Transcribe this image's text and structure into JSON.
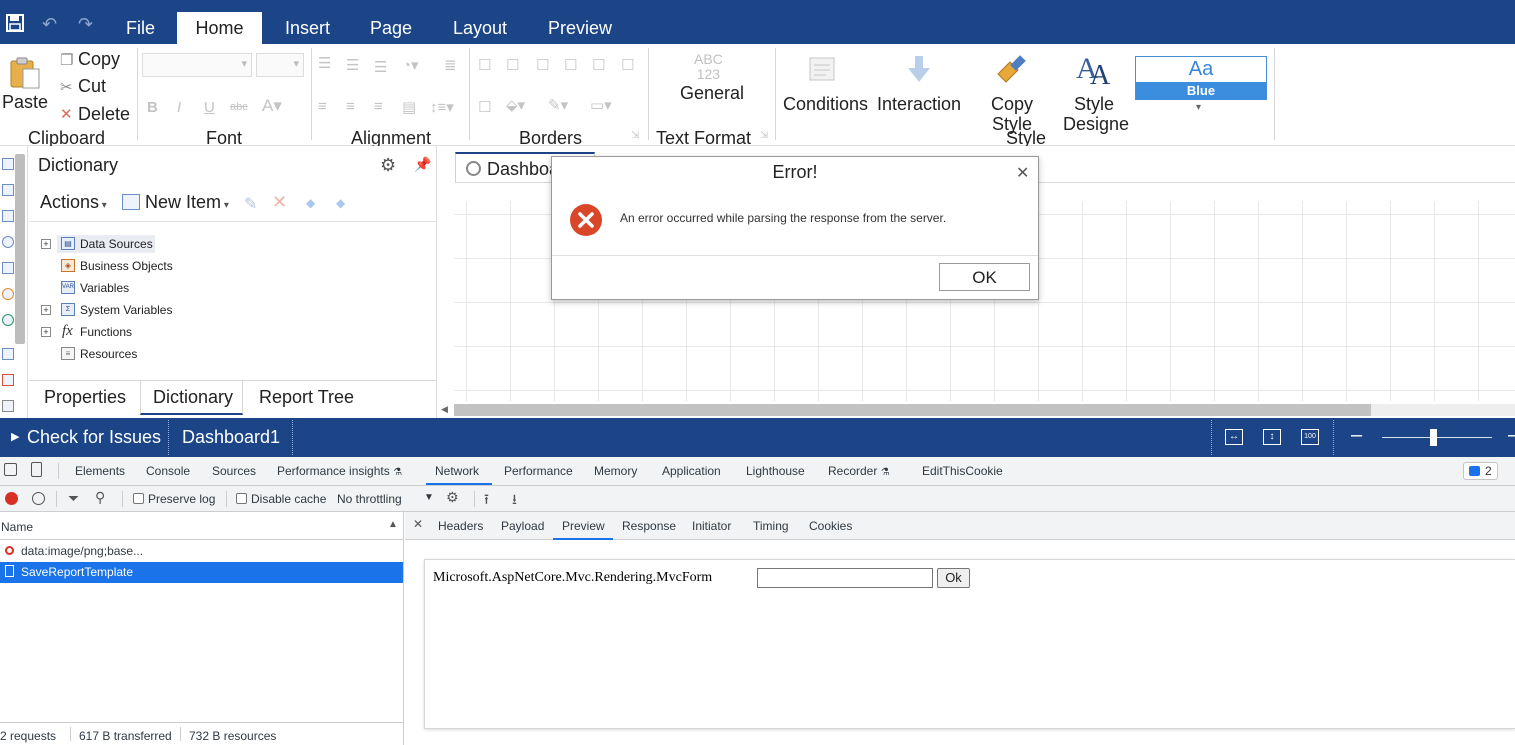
{
  "menu": {
    "tabs": [
      "File",
      "Home",
      "Insert",
      "Page",
      "Layout",
      "Preview"
    ],
    "active": "Home"
  },
  "ribbon": {
    "clipboard": {
      "paste": "Paste",
      "copy": "Copy",
      "cut": "Cut",
      "delete": "Delete",
      "group": "Clipboard"
    },
    "font_group": "Font",
    "alignment_group": "Alignment",
    "borders_group": "Borders",
    "text_format": {
      "preview": "ABC\n123",
      "value": "General",
      "group": "Text Format"
    },
    "conditions": "Conditions",
    "interaction": "Interaction",
    "copy_style": [
      "Copy",
      "Style"
    ],
    "style_group": "Style",
    "style_designer": [
      "Style",
      "Designe"
    ],
    "theme": {
      "aa": "Aa",
      "name": "Blue"
    }
  },
  "dictionary": {
    "title": "Dictionary",
    "actions": "Actions",
    "new_item": "New Item",
    "items": [
      {
        "label": "Data Sources",
        "expandable": true,
        "icon": "data-sources-icon"
      },
      {
        "label": "Business Objects",
        "expandable": false,
        "icon": "business-objects-icon"
      },
      {
        "label": "Variables",
        "expandable": false,
        "icon": "variables-icon"
      },
      {
        "label": "System Variables",
        "expandable": true,
        "icon": "system-variables-icon"
      },
      {
        "label": "Functions",
        "expandable": true,
        "icon": "functions-icon"
      },
      {
        "label": "Resources",
        "expandable": false,
        "icon": "resources-icon"
      }
    ],
    "bottom_tabs": [
      "Properties",
      "Dictionary",
      "Report Tree"
    ],
    "active_bottom_tab": "Dictionary"
  },
  "designer": {
    "tab_label": "Dashboa"
  },
  "statusbar": {
    "check": "Check for Issues",
    "page": "Dashboard1"
  },
  "dialog": {
    "title": "Error!",
    "message": "An error occurred while parsing the response from the server.",
    "ok": "OK"
  },
  "devtools": {
    "tabs": [
      "Elements",
      "Console",
      "Sources",
      "Performance insights",
      "Network",
      "Performance",
      "Memory",
      "Application",
      "Lighthouse",
      "Recorder",
      "EditThisCookie"
    ],
    "active_tab": "Network",
    "issues_count": "2",
    "preserve_log": "Preserve log",
    "disable_cache": "Disable cache",
    "throttling": "No throttling",
    "name_header": "Name",
    "requests": [
      {
        "name": "data:image/png;base...",
        "selected": false
      },
      {
        "name": "SaveReportTemplate",
        "selected": true
      }
    ],
    "detail_tabs": [
      "Headers",
      "Payload",
      "Preview",
      "Response",
      "Initiator",
      "Timing",
      "Cookies"
    ],
    "active_detail_tab": "Preview",
    "preview": {
      "text": "Microsoft.AspNetCore.Mvc.Rendering.MvcForm",
      "button": "Ok"
    },
    "summary": {
      "requests": "2 requests",
      "transferred": "617 B transferred",
      "resources": "732 B resources"
    }
  },
  "colors": {
    "brand": "#1b4587",
    "error": "#d9472b",
    "devtools_selected": "#1a73e8"
  }
}
